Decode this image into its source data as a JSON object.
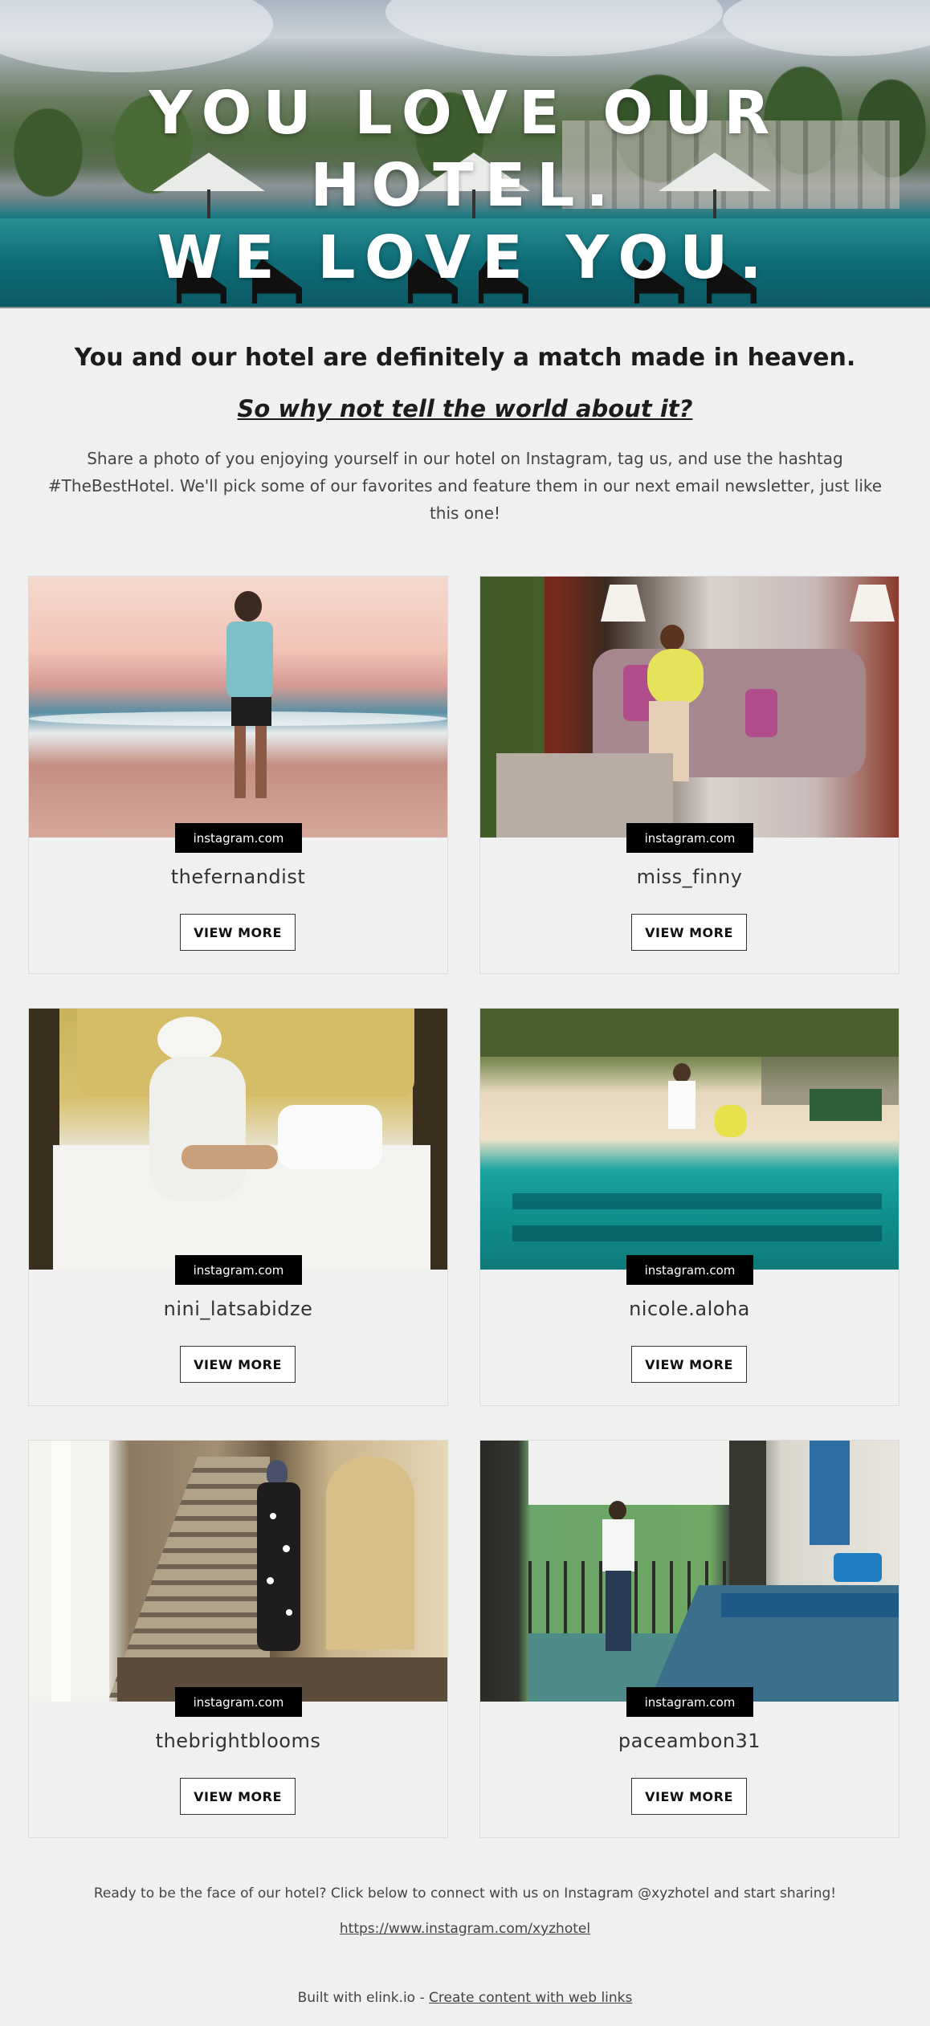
{
  "hero": {
    "headline_line1": "YOU LOVE OUR HOTEL.",
    "headline_line2": "WE LOVE YOU."
  },
  "intro": {
    "heading": "You and our hotel are definitely a match made in heaven.",
    "subheading": "So why not tell the world about it?",
    "body": "Share a photo of you enjoying yourself in our hotel on Instagram, tag us, and use the hashtag #TheBestHotel. We'll pick some of our favorites and feature them in our next email newsletter, just like this one!"
  },
  "posts": [
    {
      "source": "instagram.com",
      "username": "thefernandist",
      "button": "VIEW MORE"
    },
    {
      "source": "instagram.com",
      "username": "miss_finny",
      "button": "VIEW MORE"
    },
    {
      "source": "instagram.com",
      "username": "nini_latsabidze",
      "button": "VIEW MORE"
    },
    {
      "source": "instagram.com",
      "username": "nicole.aloha",
      "button": "VIEW MORE"
    },
    {
      "source": "instagram.com",
      "username": "thebrightblooms",
      "button": "VIEW MORE"
    },
    {
      "source": "instagram.com",
      "username": "paceambon31",
      "button": "VIEW MORE"
    }
  ],
  "footer": {
    "cta": "Ready to be the face of our hotel? Click below to connect with us on Instagram @xyzhotel and start sharing!",
    "link": "https://www.instagram.com/xyzhotel",
    "built_prefix": "Built with elink.io - ",
    "built_link": "Create content with web links"
  },
  "colors": {
    "page_background": "#eff0ef",
    "badge_background": "#000000",
    "text_dark": "#1c1c1c"
  }
}
